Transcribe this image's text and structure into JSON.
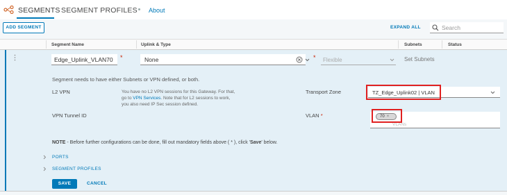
{
  "tabs": {
    "segments": "SEGMENTS",
    "segment_profiles": "SEGMENT PROFILES",
    "about": "About"
  },
  "toolbar": {
    "add_segment": "ADD SEGMENT",
    "expand_all": "EXPAND ALL",
    "search_placeholder": "Search"
  },
  "table": {
    "columns": [
      "Segment Name",
      "Uplink & Type",
      "Subnets",
      "Status"
    ]
  },
  "row": {
    "segment_name": "Edge_Uplink_VLAN70",
    "uplink_type": "None",
    "flexible": "Flexible",
    "set_subnets": "Set Subnets",
    "notice": "Segment needs to have either Subnets or VPN defined, or both.",
    "l2vpn_label": "L2 VPN",
    "l2vpn_msg_1": "You have no L2 VPN sessions for this Gateway. For that,",
    "l2vpn_msg_2a": "go to ",
    "l2vpn_link": "VPN Services",
    "l2vpn_msg_2b": ". Note that for L2 sessions to work,",
    "l2vpn_msg_3": "you also need IP Sec session defined.",
    "transport_zone_label": "Transport Zone",
    "transport_zone_value": "TZ_Edge_Uplink02 | VLAN",
    "vpn_tunnel_label": "VPN Tunnel ID",
    "vlan_label": "VLAN",
    "vlan_chip": "70",
    "vlan_placeholder": "VLANs",
    "note_prefix": "NOTE",
    "note_text_1": " - Before further configurations can be done, fill out mandatory fields above ( * ), click '",
    "note_save": "Save",
    "note_text_2": "' below.",
    "ports": "PORTS",
    "segment_profiles": "SEGMENT PROFILES",
    "save": "SAVE",
    "cancel": "CANCEL"
  },
  "colors": {
    "accent": "#0079b8",
    "highlight": "#e02020",
    "required": "#c92100"
  }
}
